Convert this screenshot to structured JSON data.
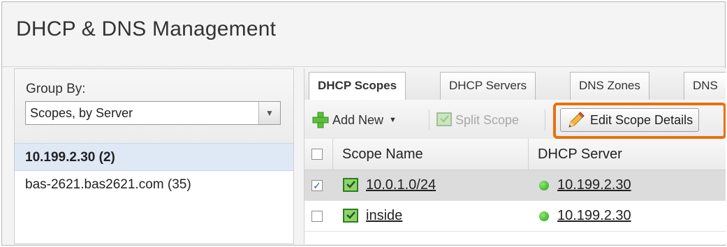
{
  "page": {
    "title": "DHCP & DNS Management"
  },
  "left": {
    "group_by_label": "Group By:",
    "group_by_value": "Scopes, by Server",
    "servers": [
      {
        "label": "10.199.2.30 (2)",
        "selected": true
      },
      {
        "label": "bas-2621.bas2621.com (35)",
        "selected": false
      }
    ]
  },
  "tabs": [
    {
      "label": "DHCP Scopes",
      "active": true
    },
    {
      "label": "DHCP Servers",
      "active": false
    },
    {
      "label": "DNS Zones",
      "active": false
    },
    {
      "label": "DNS",
      "active": false
    }
  ],
  "toolbar": {
    "add_new": "Add New",
    "split_scope": "Split Scope",
    "edit_scope_details": "Edit Scope Details"
  },
  "grid": {
    "columns": [
      "Scope Name",
      "DHCP Server"
    ],
    "rows": [
      {
        "checked": true,
        "scope": "10.0.1.0/24",
        "server": "10.199.2.30"
      },
      {
        "checked": false,
        "scope": "inside",
        "server": "10.199.2.30"
      }
    ]
  },
  "colors": {
    "highlight": "#e8700f",
    "status_green": "#24a217"
  }
}
